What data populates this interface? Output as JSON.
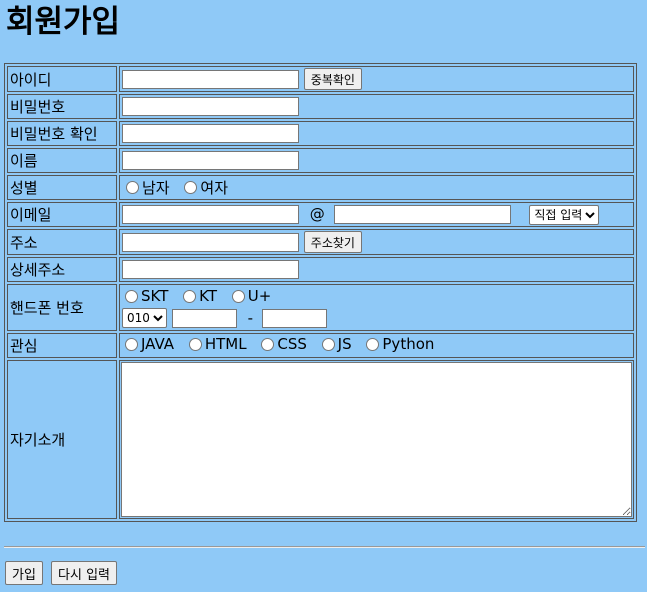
{
  "page_title": "회원가입",
  "labels": {
    "id": "아이디",
    "password": "비밀번호",
    "password_confirm": "비밀번호 확인",
    "name": "이름",
    "gender": "성별",
    "email": "이메일",
    "address": "주소",
    "address_detail": "상세주소",
    "phone": "핸드폰 번호",
    "interest": "관심",
    "intro": "자기소개"
  },
  "buttons": {
    "dup_check": "중복확인",
    "find_address": "주소찾기",
    "submit": "가입",
    "reset": "다시 입력"
  },
  "gender_options": [
    "남자",
    "여자"
  ],
  "email": {
    "at": "@",
    "domain_select": "직접 입력"
  },
  "carriers": [
    "SKT",
    "KT",
    "U+"
  ],
  "phone": {
    "prefix": "010",
    "separator": "-"
  },
  "interests": [
    "JAVA",
    "HTML",
    "CSS",
    "JS",
    "Python"
  ]
}
